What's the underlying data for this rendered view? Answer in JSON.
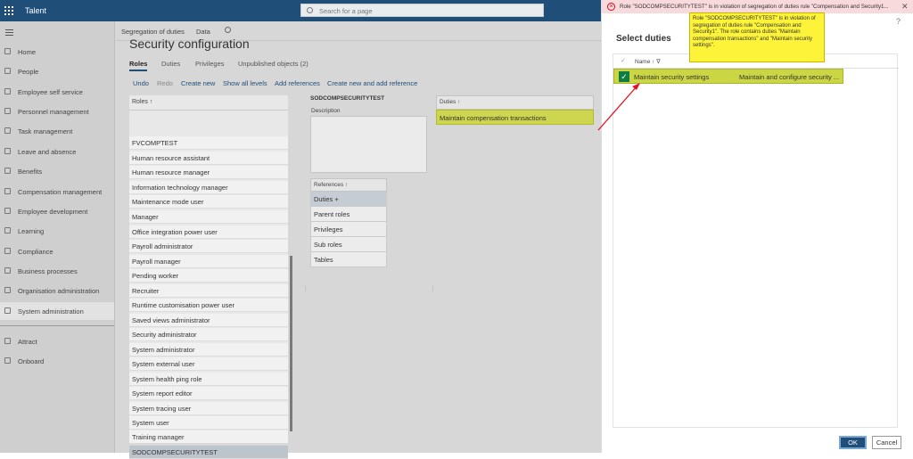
{
  "topbar": {
    "app_name": "Talent",
    "search_placeholder": "Search for a page"
  },
  "nav": {
    "items": [
      {
        "label": "Home",
        "icon": "home-icon"
      },
      {
        "label": "People",
        "icon": "people-icon"
      },
      {
        "label": "Employee self service",
        "icon": "person-icon"
      },
      {
        "label": "Personnel management",
        "icon": "folder-icon"
      },
      {
        "label": "Task management",
        "icon": "task-icon"
      },
      {
        "label": "Leave and absence",
        "icon": "leave-icon"
      },
      {
        "label": "Benefits",
        "icon": "benefits-icon"
      },
      {
        "label": "Compensation management",
        "icon": "compensation-icon"
      },
      {
        "label": "Employee development",
        "icon": "development-icon"
      },
      {
        "label": "Learning",
        "icon": "learning-icon"
      },
      {
        "label": "Compliance",
        "icon": "compliance-icon"
      },
      {
        "label": "Business processes",
        "icon": "process-icon"
      },
      {
        "label": "Organisation administration",
        "icon": "organisation-icon"
      },
      {
        "label": "System administration",
        "icon": "system-icon"
      },
      {
        "label": "Attract",
        "icon": "attract-icon"
      },
      {
        "label": "Onboard",
        "icon": "onboard-icon"
      }
    ]
  },
  "breadcrumb": {
    "item1": "Segregation of duties",
    "item2": "Data"
  },
  "page": {
    "title": "Security configuration",
    "tabs": [
      "Roles",
      "Duties",
      "Privileges",
      "Unpublished objects (2)"
    ],
    "actions": [
      "Undo",
      "Redo",
      "Create new",
      "Show all levels",
      "Add references",
      "Create new and add reference"
    ]
  },
  "roles": {
    "header": "Roles  ↑",
    "items": [
      "FVCOMPTEST",
      "Human resource assistant",
      "Human resource manager",
      "Information technology manager",
      "Maintenance mode user",
      "Manager",
      "Office integration power user",
      "Payroll administrator",
      "Payroll manager",
      "Pending worker",
      "Recruiter",
      "Runtime customisation power user",
      "Saved views administrator",
      "Security administrator",
      "System administrator",
      "System external user",
      "System health ping role",
      "System report editor",
      "System tracing user",
      "System user",
      "Training manager",
      "SODCOMPSECURITYTEST"
    ]
  },
  "details": {
    "name": "SODCOMPSECURITYTEST",
    "description_label": "Description",
    "references_header": "References  ↑",
    "references": [
      "Duties +",
      "Parent roles",
      "Privileges",
      "Sub roles",
      "Tables"
    ]
  },
  "duties": {
    "header": "Duties  ↑",
    "items": [
      "Maintain compensation transactions"
    ]
  },
  "dialog": {
    "error_message": "Role \"SODCOMPSECURITYTEST\" is in violation of segregation of duties rule \"Compensation and Security1...",
    "tooltip": "Role \"SODCOMPSECURITYTEST\" is in violation of segregation of duties rule \"Compensation and Security1\". The role contains duties \"Maintain compensation transactions\" and \"Maintain security settings\".",
    "title": "Select duties",
    "help": "?",
    "col_name": "Name  ↑  ∇",
    "rows": [
      {
        "name": "Maintain security settings",
        "description": "Maintain and configure security ..."
      }
    ],
    "ok": "OK",
    "cancel": "Cancel"
  },
  "colors": {
    "accent": "#1f4e79",
    "highlight": "#cbd645",
    "error_bg": "#f9dadc",
    "tooltip": "#fdf43a"
  }
}
